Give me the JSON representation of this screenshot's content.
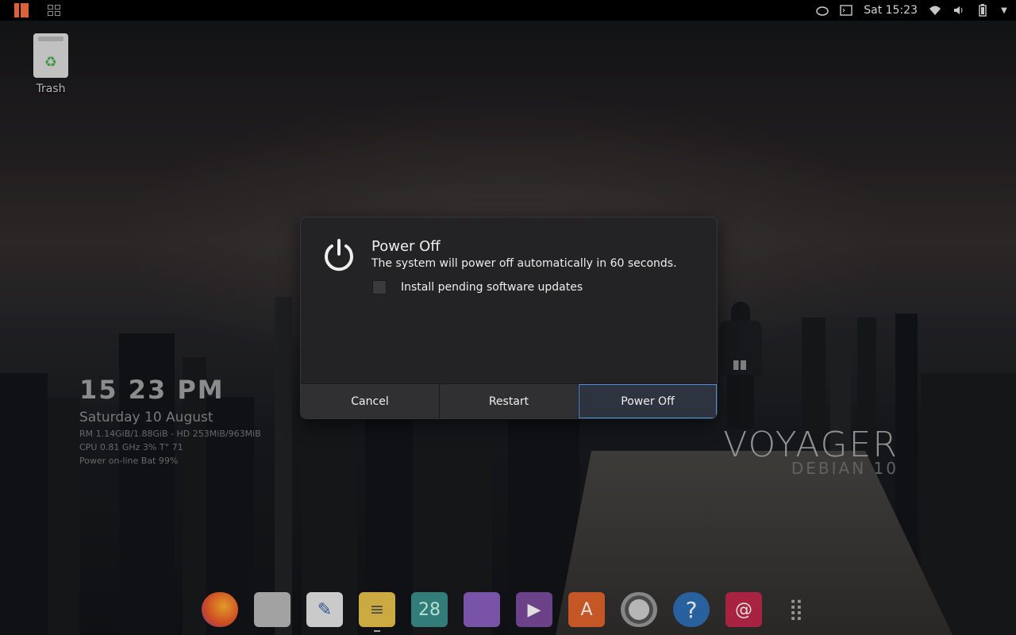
{
  "topbar": {
    "clock": "Sat 15:23",
    "accent": "#d9623a"
  },
  "desktop": {
    "trash_label": "Trash"
  },
  "conky": {
    "time": "15 23 PM",
    "date": "Saturday 10 August",
    "memory": "RM 1.14GiB/1.88GiB - HD 253MiB/963MiB",
    "cpu": "CPU 0.81 GHz 3% T° 71",
    "power": "Power on-line Bat 99%"
  },
  "branding": {
    "title": "VOYAGER",
    "subtitle": "DEBIAN 10"
  },
  "dock": {
    "calendar_day": "28"
  },
  "dialog": {
    "title": "Power Off",
    "message": "The system will power off automatically in 60 seconds.",
    "checkbox_label": "Install pending software updates",
    "checkbox_checked": false,
    "buttons": {
      "cancel": "Cancel",
      "restart": "Restart",
      "power_off": "Power Off"
    },
    "default_button_color": "#4a90d9"
  }
}
